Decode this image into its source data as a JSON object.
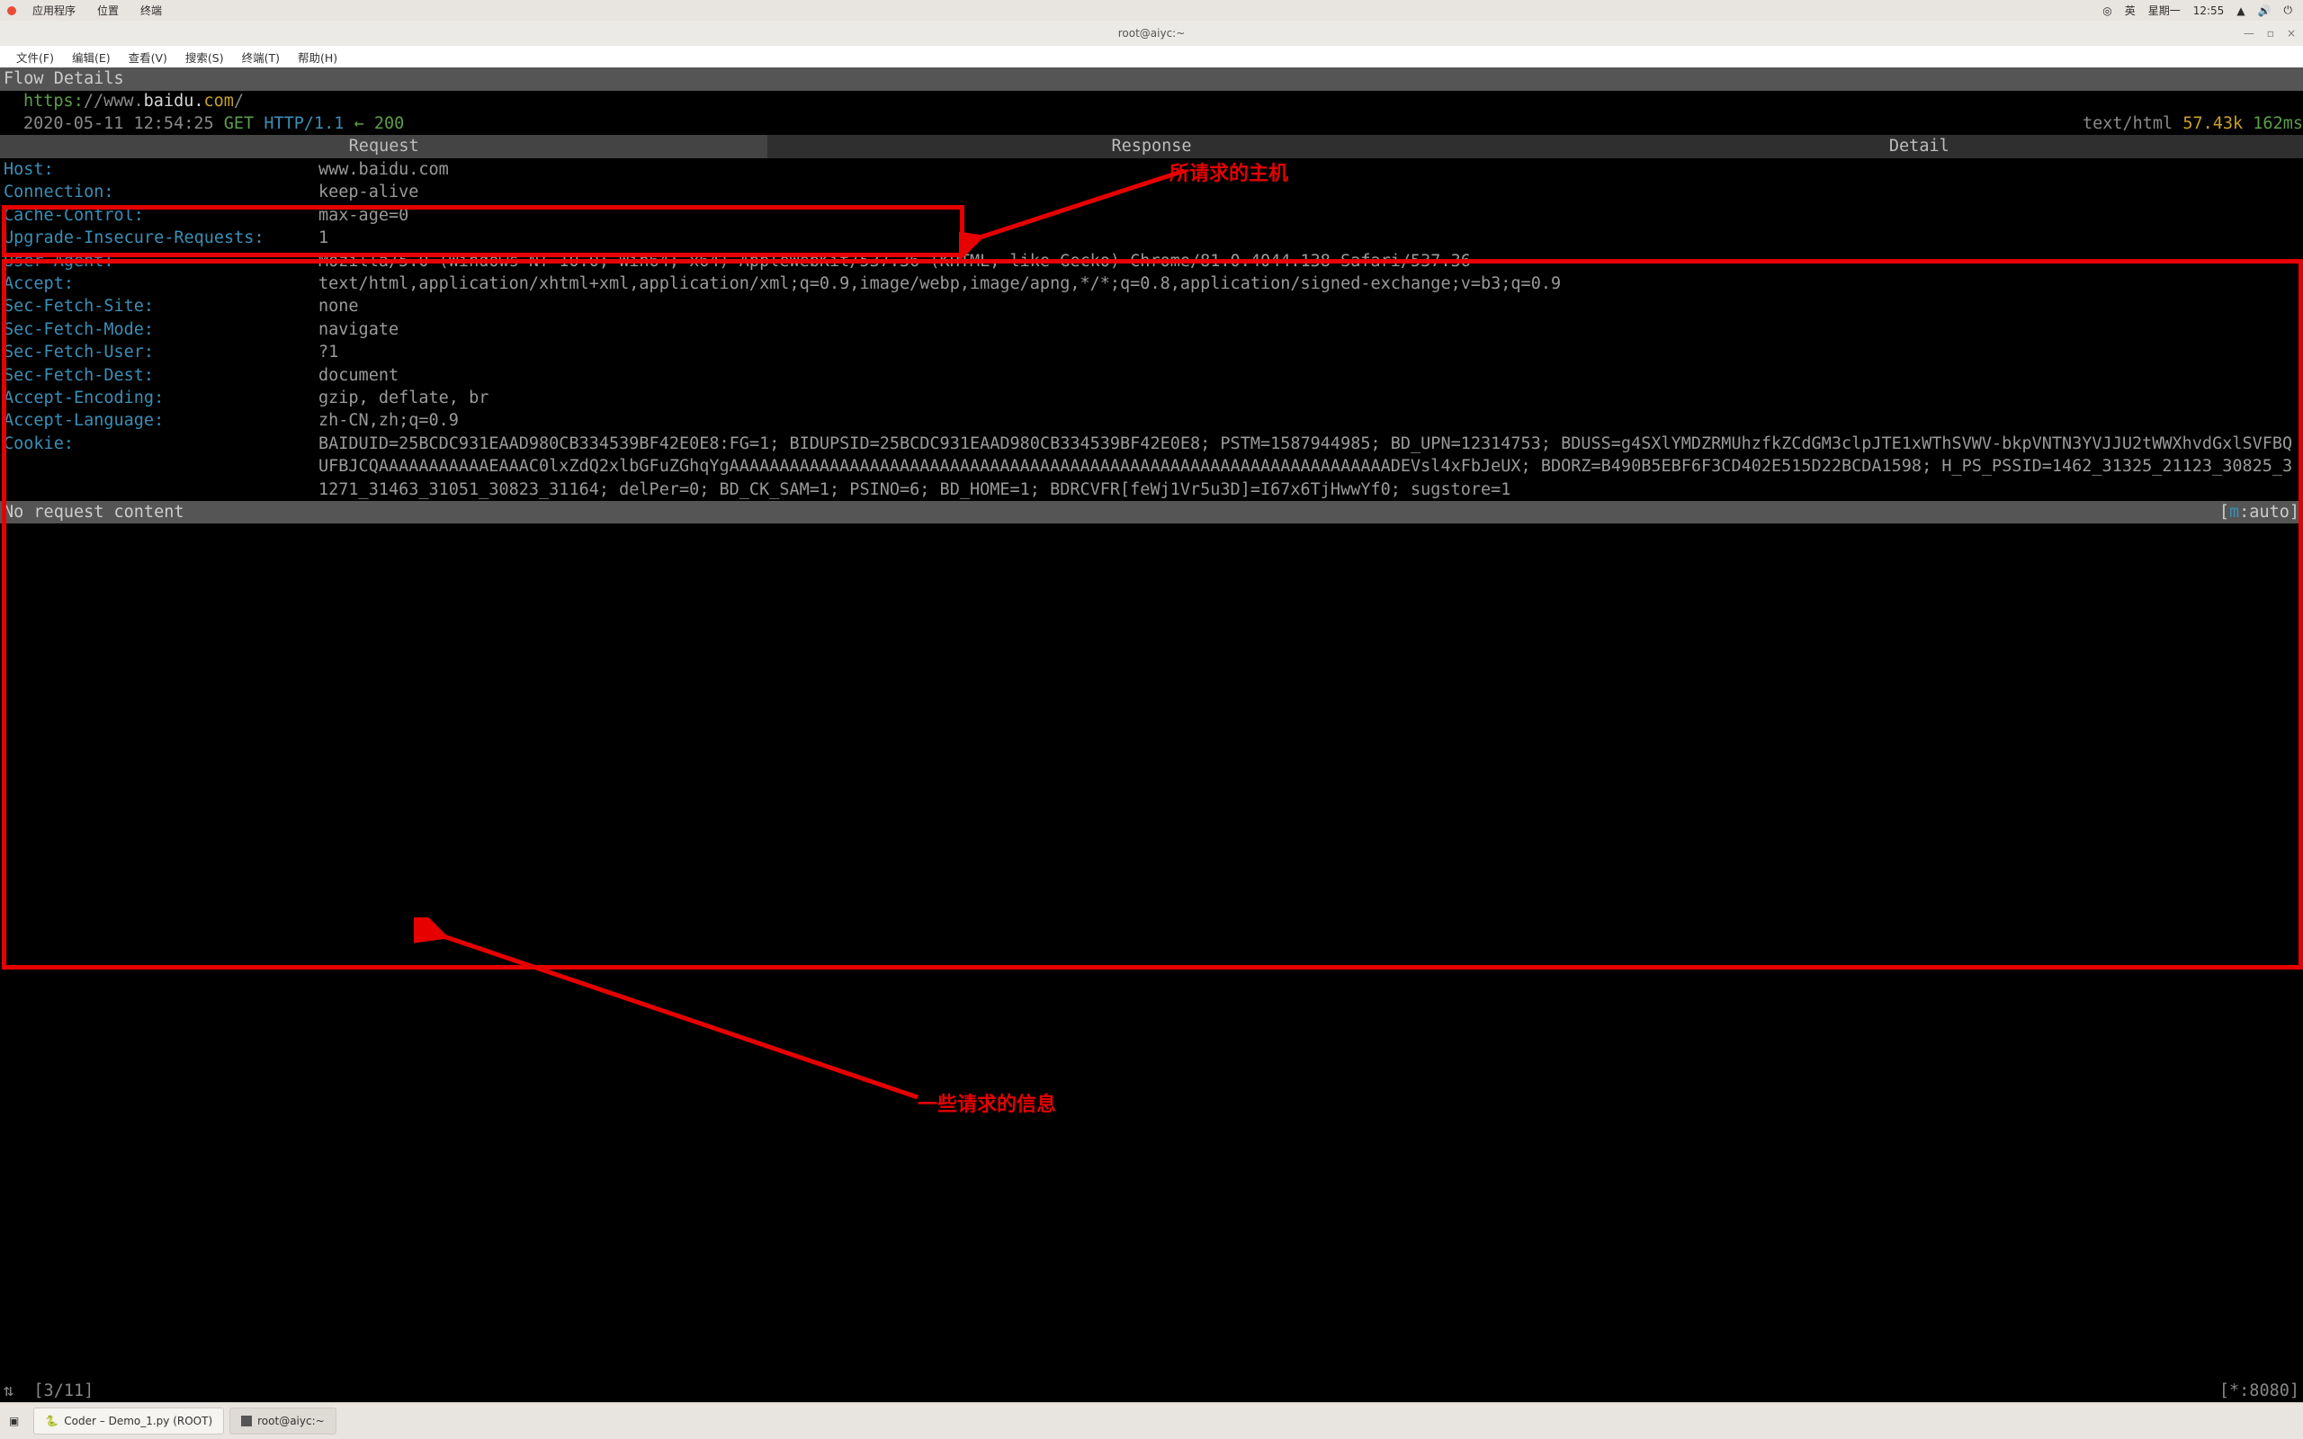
{
  "topbar": {
    "menus": [
      "应用程序",
      "位置",
      "终端"
    ],
    "tray": {
      "a11y": "◎",
      "ime": "英",
      "day": "星期一",
      "time": "12:55",
      "net": "▲",
      "vol": "🔊",
      "power": "⏻"
    }
  },
  "window": {
    "title": "root@aiyc:~",
    "btns": {
      "min": "—",
      "max": "▫",
      "close": "×"
    }
  },
  "menubar": [
    "文件(F)",
    "编辑(E)",
    "查看(V)",
    "搜索(S)",
    "终端(T)",
    "帮助(H)"
  ],
  "mitm": {
    "header": "Flow Details",
    "url": {
      "scheme": "https:",
      "sep": "//",
      "sub": "www.",
      "domain": "baidu.",
      "tld": "com",
      "trail": "/"
    },
    "info": {
      "timestamp": "2020-05-11 12:54:25",
      "method": "GET",
      "proto": "HTTP/1.1",
      "arrow": "←",
      "status": "200",
      "ctype": "text/html",
      "size": "57.43k",
      "time": "162ms"
    },
    "tabs": [
      "Request",
      "Response",
      "Detail"
    ],
    "headers": [
      {
        "k": "Host:",
        "v": "www.baidu.com"
      },
      {
        "k": "Connection:",
        "v": "keep-alive"
      },
      {
        "k": "Cache-Control:",
        "v": "max-age=0"
      },
      {
        "k": "Upgrade-Insecure-Requests:",
        "v": "1"
      },
      {
        "k": "User-Agent:",
        "v": "Mozilla/5.0 (Windows NT 10.0; Win64; x64) AppleWebKit/537.36 (KHTML, like Gecko) Chrome/81.0.4044.138 Safari/537.36"
      },
      {
        "k": "Accept:",
        "v": "text/html,application/xhtml+xml,application/xml;q=0.9,image/webp,image/apng,*/*;q=0.8,application/signed-exchange;v=b3;q=0.9"
      },
      {
        "k": "Sec-Fetch-Site:",
        "v": "none"
      },
      {
        "k": "Sec-Fetch-Mode:",
        "v": "navigate"
      },
      {
        "k": "Sec-Fetch-User:",
        "v": "?1"
      },
      {
        "k": "Sec-Fetch-Dest:",
        "v": "document"
      },
      {
        "k": "Accept-Encoding:",
        "v": "gzip, deflate, br"
      },
      {
        "k": "Accept-Language:",
        "v": "zh-CN,zh;q=0.9"
      },
      {
        "k": "Cookie:",
        "v": "BAIDUID=25BCDC931EAAD980CB334539BF42E0E8:FG=1; BIDUPSID=25BCDC931EAAD980CB334539BF42E0E8; PSTM=1587944985; BD_UPN=12314753; BDUSS=g4SXlYMDZRMUhzfkZCdGM3clpJTE1xWThSVWV-bkpVNTN3YVJJU2tWWXhvdGxlSVFBQUFBJCQAAAAAAAAAAAEAAAC0lxZdQ2xlbGFuZGhqYgAAAAAAAAAAAAAAAAAAAAAAAAAAAAAAAAAAAAAAAAAAAAAAAAAAAAAAAAAAAAAAAAAADEVsl4xFbJeUX; BDORZ=B490B5EBF6F3CD402E515D22BCDA1598; H_PS_PSSID=1462_31325_21123_30825_31271_31463_31051_30823_31164; delPer=0; BD_CK_SAM=1; PSINO=6; BD_HOME=1; BDRCVFR[feWj1Vr5u3D]=I67x6TjHwwYf0; sugstore=1"
      }
    ],
    "status_left": "No request content",
    "status_right_pre": "[",
    "status_right_key": "m",
    "status_right_post": ":auto]",
    "bottom_left_a": "⇅",
    "bottom_left_b": "[3/11]",
    "bottom_right": "[*:8080]"
  },
  "annotations": {
    "label1": "所请求的主机",
    "label2": "一些请求的信息"
  },
  "taskbar": {
    "desktop_icon": "▣",
    "items": [
      {
        "icon": "🐍",
        "label": "Coder – Demo_1.py (ROOT)"
      },
      {
        "icon": "▣",
        "label": "root@aiyc:~"
      }
    ]
  }
}
